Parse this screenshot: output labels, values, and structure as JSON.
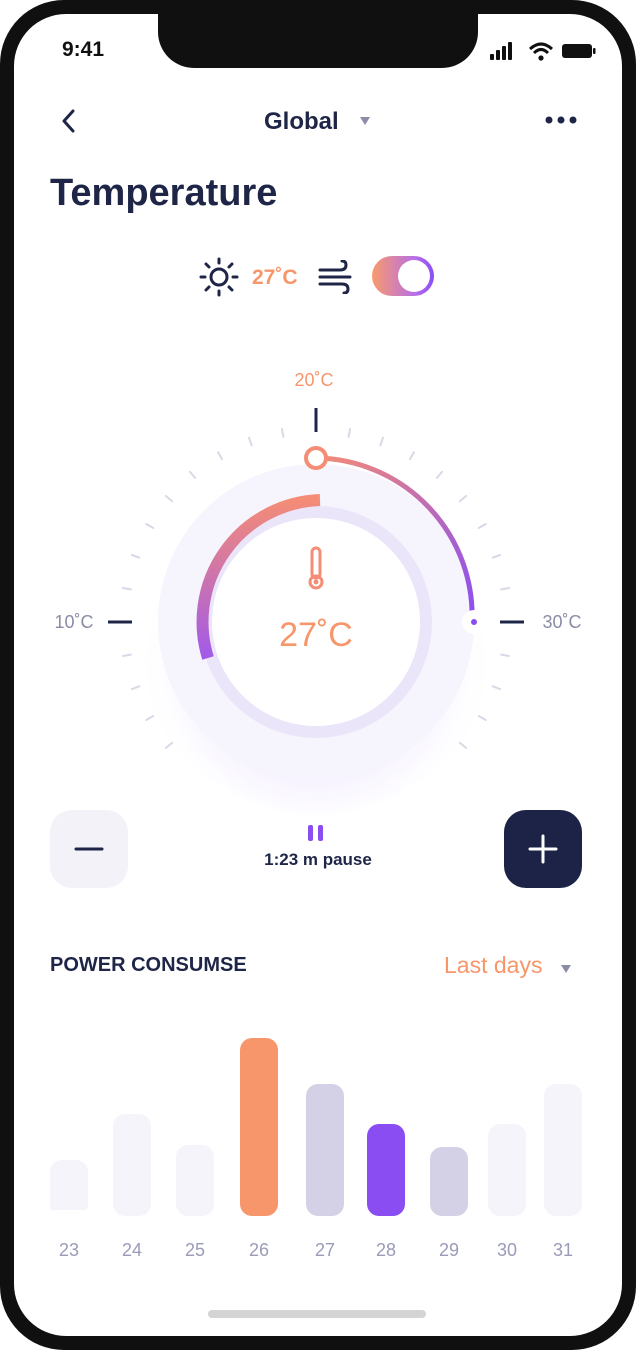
{
  "status_bar": {
    "time": "9:41"
  },
  "nav": {
    "title": "Global",
    "back_icon": "chevron-left-icon",
    "more_icon": "more-horizontal-icon"
  },
  "page": {
    "title": "Temperature"
  },
  "mode": {
    "outdoor_temp": "27˚C",
    "fan_enabled": true
  },
  "dial": {
    "current_temp": "27˚C",
    "min_label": "10˚C",
    "mid_label": "20˚C",
    "max_label": "30˚C",
    "value": 27
  },
  "controls": {
    "timer_text": "1:23 m pause"
  },
  "power": {
    "title": "POWER CONSUMSE",
    "range_label": "Last days"
  },
  "colors": {
    "navy": "#1e2547",
    "orange": "#f7966a",
    "purple": "#8a4df2",
    "lavender": "#d4d1e6",
    "pale": "#f5f4fa"
  },
  "chart_data": {
    "type": "bar",
    "categories": [
      "23",
      "24",
      "25",
      "26",
      "27",
      "28",
      "29",
      "30",
      "31"
    ],
    "values": [
      50,
      96,
      65,
      172,
      126,
      86,
      63,
      86,
      126
    ],
    "highlight": {
      "26": "orange",
      "28": "purple",
      "27": "lavender",
      "29": "lavender"
    }
  }
}
